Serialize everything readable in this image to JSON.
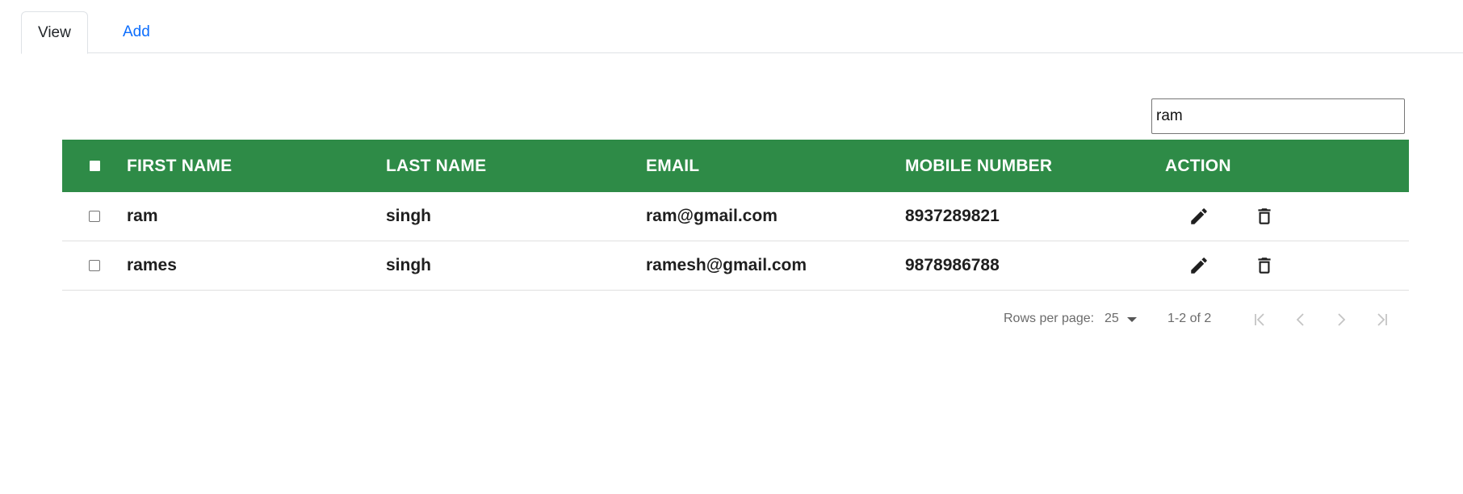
{
  "tabs": [
    {
      "label": "View",
      "active": true
    },
    {
      "label": "Add",
      "active": false
    }
  ],
  "search": {
    "value": "ram"
  },
  "table": {
    "header_color": "#2e8b47",
    "columns": [
      "FIRST NAME",
      "LAST NAME",
      "EMAIL",
      "MOBILE NUMBER",
      "ACTION"
    ],
    "rows": [
      {
        "first": "ram",
        "last": "singh",
        "email": "ram@gmail.com",
        "mobile": "8937289821"
      },
      {
        "first": "rames",
        "last": "singh",
        "email": "ramesh@gmail.com",
        "mobile": "9878986788"
      }
    ]
  },
  "pagination": {
    "rows_per_page_label": "Rows per page:",
    "rows_per_page_value": "25",
    "range": "1-2 of 2"
  }
}
